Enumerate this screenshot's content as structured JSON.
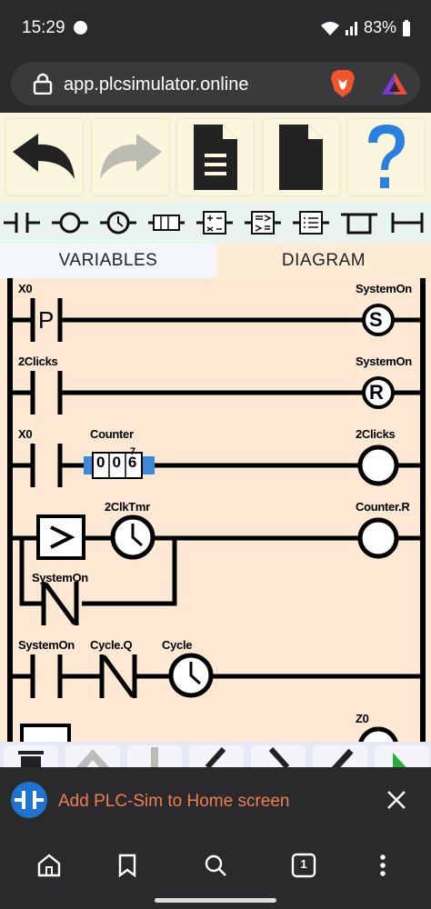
{
  "status_bar": {
    "time": "15:29",
    "battery": "83%",
    "icons": [
      "spotify-icon",
      "wifi-icon",
      "signal-icon",
      "battery-icon"
    ]
  },
  "browser": {
    "url": "app.plcsimulator.online"
  },
  "toolbar": {
    "main_icons": [
      "undo-icon",
      "redo-icon",
      "new-document-icon",
      "open-document-icon",
      "help-icon"
    ],
    "element_icons": [
      "contact-icon",
      "coil-icon",
      "timer-icon",
      "counter-icon",
      "math-icon",
      "compare-icon",
      "list-icon",
      "box-icon",
      "branch-icon"
    ]
  },
  "tabs": [
    {
      "label": "VARIABLES"
    },
    {
      "label": "DIAGRAM"
    }
  ],
  "diagram": {
    "rungs": [
      {
        "left": [
          "X0"
        ],
        "right": "SystemOn",
        "coil": "S",
        "contact_mark": "P"
      },
      {
        "left": [
          "2Clicks"
        ],
        "right": "SystemOn",
        "coil": "R"
      },
      {
        "left": [
          "X0",
          "Counter"
        ],
        "right": "2Clicks",
        "counter_value": "006",
        "counter_super": "7"
      },
      {
        "left": [
          "2ClkTmr"
        ],
        "right": "Counter.R",
        "branch": "SystemOn"
      },
      {
        "left": [
          "SystemOn",
          "Cycle.Q",
          "Cycle"
        ]
      },
      {
        "right": "Z0"
      }
    ]
  },
  "bottom_toolbar": {
    "icons": [
      "trash-icon",
      "up-icon",
      "down-icon",
      "left-icon",
      "right-icon",
      "edit-icon",
      "run-icon"
    ]
  },
  "banner": {
    "text": "Add PLC-Sim to Home screen"
  },
  "bottom_nav": {
    "icons": [
      "home-icon",
      "bookmark-icon",
      "search-icon",
      "tabs-icon",
      "menu-icon"
    ],
    "tab_count": "1"
  },
  "colors": {
    "diagram_bg": "#fde9d3",
    "toolbar_bg": "#f7f3dc",
    "banner_text": "#ee7f51",
    "browser_bg": "#2a2a2c"
  }
}
